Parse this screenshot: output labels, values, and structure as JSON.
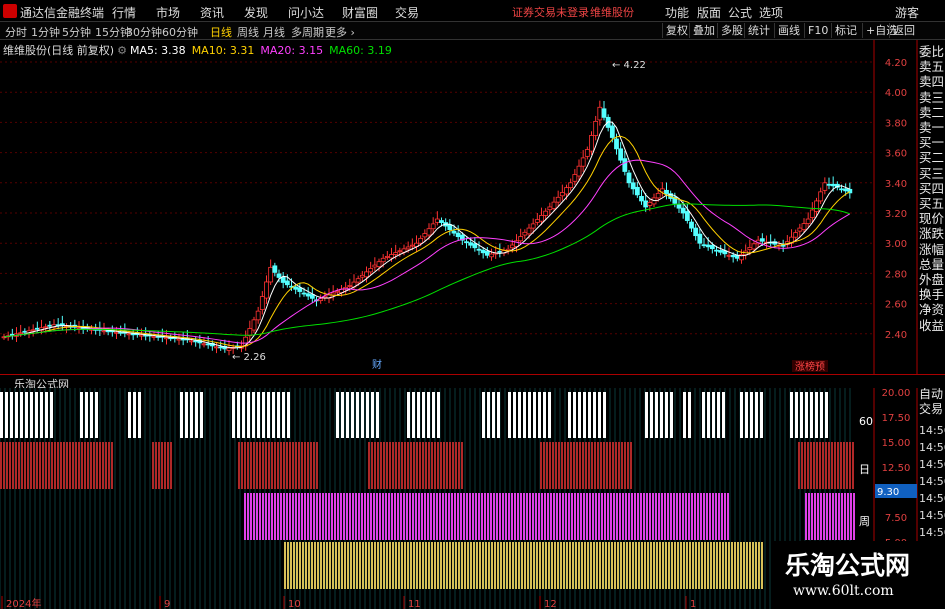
{
  "app": {
    "title": "通达信金融终端",
    "menu": [
      "行情",
      "市场",
      "资讯",
      "发现",
      "问小达",
      "财富圈",
      "交易"
    ],
    "login_notice": "证券交易未登录",
    "broker": "维维股份",
    "right_menu": [
      "功能",
      "版面",
      "公式",
      "选项"
    ],
    "guest": "游客"
  },
  "toolbar": {
    "periods": [
      "分时",
      "1分钟",
      "5分钟",
      "15分钟",
      "30分钟",
      "60分钟",
      "日线",
      "周线",
      "月线",
      "多周期",
      "更多 ›"
    ],
    "active": "日线",
    "buttons": [
      "复权",
      "叠加",
      "多股",
      "统计",
      "画线",
      "F10",
      "标记",
      "+自选",
      "返回"
    ]
  },
  "stock": {
    "name": "维维股份(日线 前复权)",
    "ma": [
      {
        "label": "MA5: 3.38",
        "color": "#ffffff"
      },
      {
        "label": "MA10: 3.31",
        "color": "#ffd100"
      },
      {
        "label": "MA20: 3.15",
        "color": "#ff40ff"
      },
      {
        "label": "MA60: 3.19",
        "color": "#00e000"
      }
    ]
  },
  "price_axis": {
    "ticks": [
      "4.20",
      "4.00",
      "3.80",
      "3.60",
      "3.40",
      "3.20",
      "3.00",
      "2.80",
      "2.60",
      "2.40"
    ],
    "max_label": "4.22",
    "min_label": "2.26"
  },
  "markers": {
    "cai": "财",
    "zhangbang": "涨榜预"
  },
  "side_labels": [
    "委比",
    "卖五",
    "卖四",
    "卖三",
    "卖二",
    "卖一",
    "买一",
    "买二",
    "买三",
    "买四",
    "买五",
    "现价",
    "涨跌",
    "涨幅",
    "总量",
    "外盘",
    "换手",
    "净资",
    "收益"
  ],
  "indicator": {
    "name": "乐淘公式网",
    "row_labels": [
      "60",
      "日",
      "周"
    ],
    "scale": [
      "20.00",
      "17.50",
      "15.00",
      "12.50",
      "10.00",
      "7.50",
      "5.00"
    ],
    "current": "9.30"
  },
  "right_panel": {
    "labels": [
      "自动",
      "交易"
    ],
    "times": [
      "14:56",
      "14:56",
      "14:56",
      "14:56",
      "14:56",
      "14:56",
      "14:56",
      "14:56"
    ]
  },
  "x_axis": {
    "labels": [
      "2024年",
      "9",
      "10",
      "11",
      "12",
      "1"
    ]
  },
  "watermark": {
    "title": "乐淘公式网",
    "url": "www.60lt.com"
  }
}
